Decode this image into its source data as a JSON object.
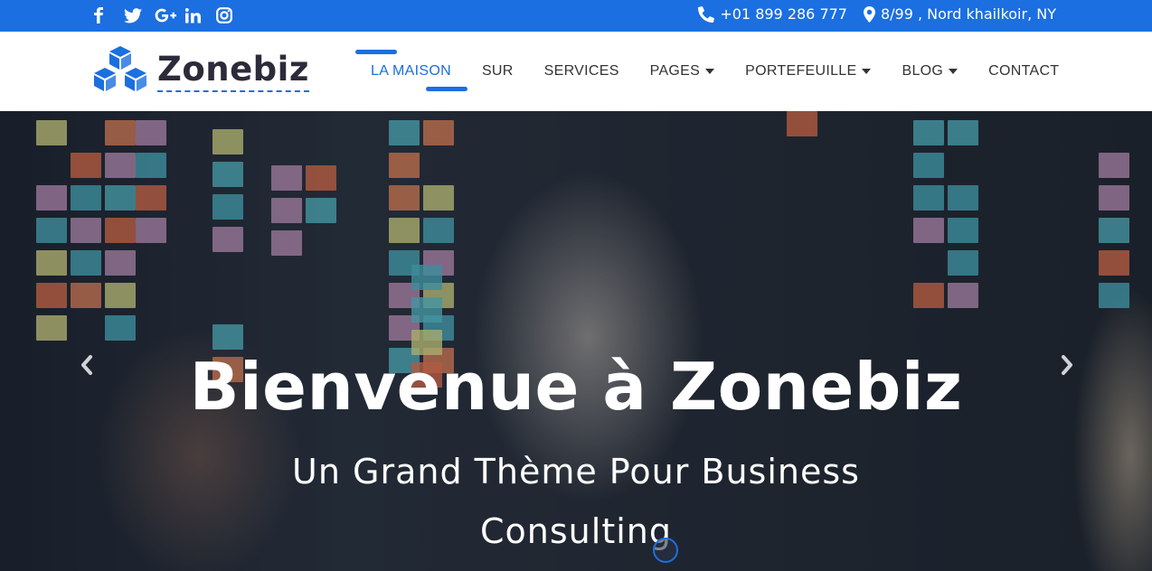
{
  "topbar": {
    "social": [
      {
        "icon": "facebook-icon",
        "label": "f"
      },
      {
        "icon": "twitter-icon",
        "label": "twitter"
      },
      {
        "icon": "google-plus-icon",
        "label": "G+"
      },
      {
        "icon": "linkedin-icon",
        "label": "in"
      },
      {
        "icon": "instagram-icon",
        "label": "instagram"
      }
    ],
    "phone": "+01 899 286 777",
    "address": "8/99 , Nord khailkoir, NY"
  },
  "header": {
    "logo_text": "Zonebiz",
    "nav": [
      {
        "label": "LA MAISON",
        "active": true,
        "dropdown": false
      },
      {
        "label": "SUR",
        "active": false,
        "dropdown": false
      },
      {
        "label": "SERVICES",
        "active": false,
        "dropdown": false
      },
      {
        "label": "PAGES",
        "active": false,
        "dropdown": true
      },
      {
        "label": "PORTEFEUILLE",
        "active": false,
        "dropdown": true
      },
      {
        "label": "BLOG",
        "active": false,
        "dropdown": true
      },
      {
        "label": "CONTACT",
        "active": false,
        "dropdown": false
      }
    ]
  },
  "hero": {
    "title": "Bienvenue à Zonebiz",
    "subtitle": "Un Grand Thème Pour Business Consulting"
  },
  "colors": {
    "brand": "#1b6fe0",
    "text_dark": "#333333",
    "logo_text": "#2b2b3a"
  }
}
